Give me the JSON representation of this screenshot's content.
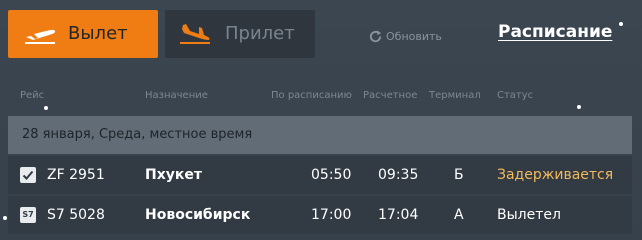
{
  "tabs": {
    "departures": {
      "label": "Вылет",
      "icon": "plane-departure-icon",
      "active": true
    },
    "arrivals": {
      "label": "Прилет",
      "icon": "plane-arrival-icon",
      "active": false
    }
  },
  "toolbar": {
    "refresh_label": "Обновить",
    "schedule_label": "Расписание"
  },
  "table": {
    "columns": {
      "flight": "Рейс",
      "destination": "Назначение",
      "scheduled": "По расписанию",
      "estimated": "Расчетное",
      "terminal": "Терминал",
      "status": "Статус"
    },
    "date_header": "28 января, Среда, местное время",
    "rows": [
      {
        "airline_icon": "check-icon",
        "flight": "ZF 2951",
        "destination": "Пхукет",
        "scheduled": "05:50",
        "estimated": "09:35",
        "terminal": "Б",
        "status": "Задерживается"
      },
      {
        "airline_icon": "s7-airline-icon",
        "airline_code": "S7",
        "flight": "S7 5028",
        "destination": "Новосибирск",
        "scheduled": "17:00",
        "estimated": "17:04",
        "terminal": "А",
        "status": "Вылетел"
      }
    ]
  },
  "colors": {
    "accent": "#f07d13",
    "delayed": "#f4b959",
    "background": "#3b4651"
  }
}
